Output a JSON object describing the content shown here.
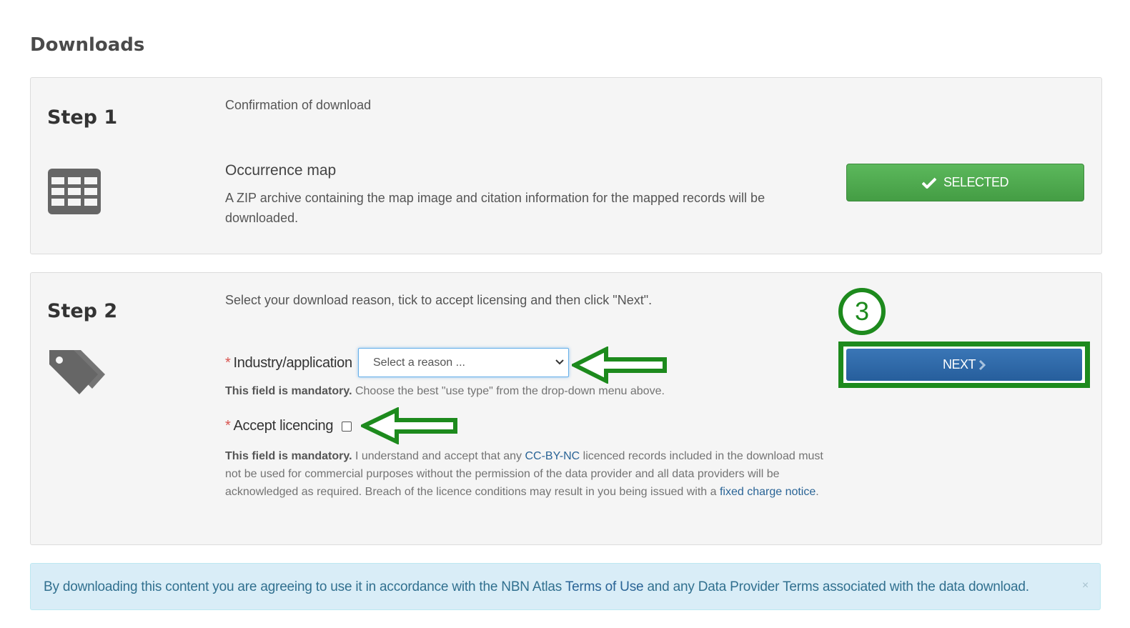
{
  "page": {
    "title": "Downloads"
  },
  "step1": {
    "label": "Step 1",
    "heading": "Confirmation of download",
    "item_title": "Occurrence map",
    "item_desc": "A ZIP archive containing the map image and citation information for the mapped records will be downloaded.",
    "selected_button": "SELECTED",
    "icon": "table-icon"
  },
  "step2": {
    "label": "Step 2",
    "instruction": "Select your download reason, tick to accept licensing and then click \"Next\".",
    "annotation_number": "3",
    "next_button": "NEXT",
    "icon": "tags-icon",
    "reason": {
      "required_mark": "*",
      "label": "Industry/application",
      "selected_value": "Select a reason ...",
      "help_bold": "This field is mandatory.",
      "help_text": " Choose the best \"use type\" from the drop-down menu above."
    },
    "licence": {
      "required_mark": "*",
      "label": "Accept licencing",
      "help_bold": "This field is mandatory.",
      "help_text_1": " I understand and accept that any ",
      "link_1": "CC-BY-NC",
      "help_text_2": " licenced records included in the download must not be used for commercial purposes without the permission of the data provider and all data providers will be acknowledged as required. Breach of the licence conditions may result in you being issued with a ",
      "link_2": "fixed charge notice",
      "help_text_3": "."
    }
  },
  "alert": {
    "text_1": "By downloading this content you are agreeing to use it in accordance with the NBN Atlas ",
    "link": "Terms of Use",
    "text_2": " and any Data Provider Terms associated with the data download.",
    "close": "×"
  },
  "colors": {
    "success": "#5cb85c",
    "primary": "#337ab7",
    "annotation_green": "#1d8a1d",
    "info_bg": "#d9edf7"
  }
}
